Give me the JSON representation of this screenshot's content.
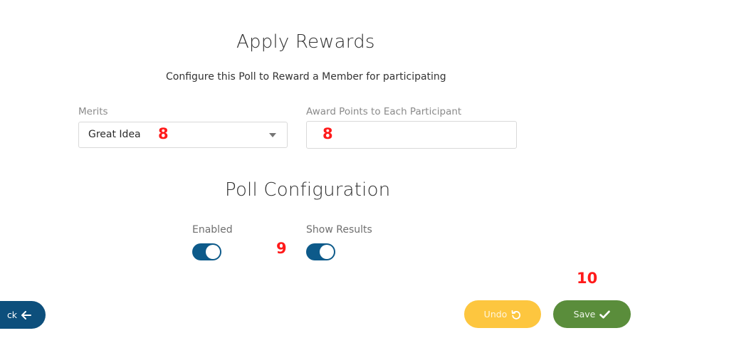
{
  "rewards": {
    "title": "Apply Rewards",
    "subtitle": "Configure this Poll to Reward a Member for participating",
    "merits": {
      "label": "Merits",
      "selected": "Great Idea"
    },
    "award_points": {
      "label": "Award Points to Each Participant",
      "value": "",
      "placeholder": ""
    }
  },
  "poll_config": {
    "title": "Poll Configuration",
    "enabled": {
      "label": "Enabled",
      "on": true
    },
    "show_results": {
      "label": "Show Results",
      "on": true
    }
  },
  "footer": {
    "back_label": "ck",
    "undo_label": "Undo",
    "save_label": "Save"
  },
  "annotations": {
    "merits": "8",
    "award_points": "8",
    "toggles": "9",
    "save": "10"
  },
  "colors": {
    "toggle_on": "#0d5a8a",
    "back_button": "#0d4f7c",
    "undo_button": "#fdc63f",
    "save_button": "#5a8d3b",
    "annotation": "#ff1a1a"
  },
  "icons": {
    "back": "arrow-left-icon",
    "undo": "undo-icon",
    "save": "check-icon",
    "dropdown": "caret-down-icon"
  }
}
